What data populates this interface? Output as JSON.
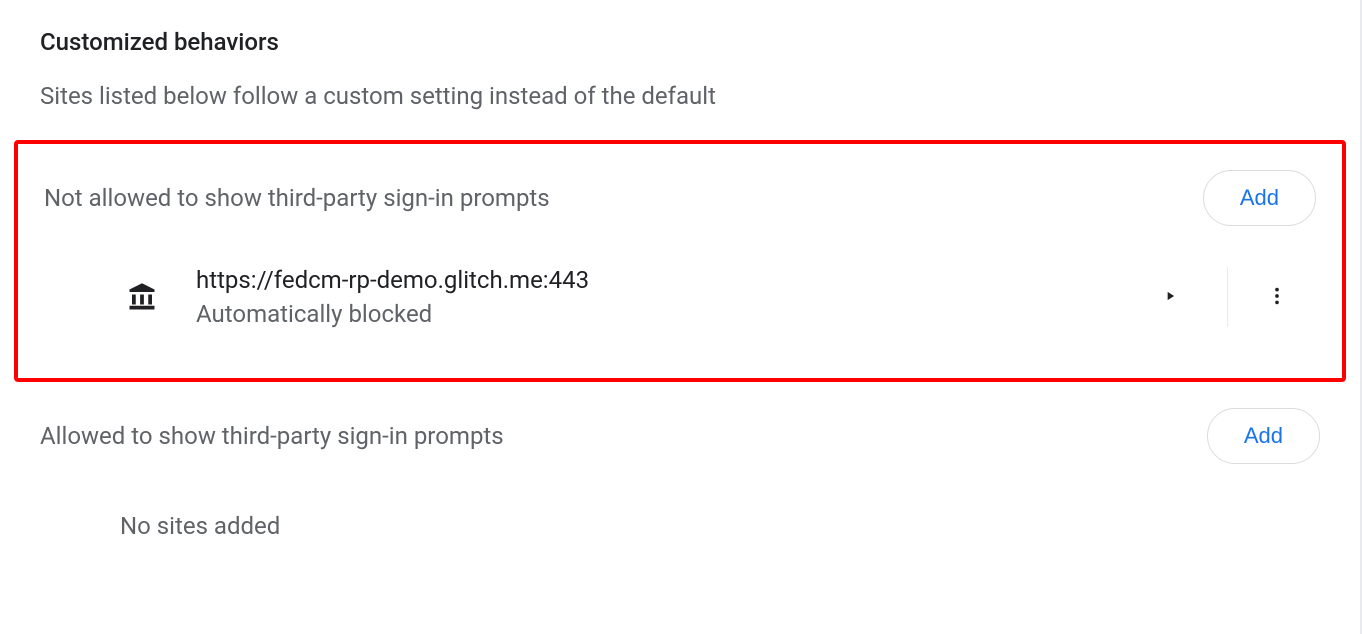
{
  "header": {
    "title": "Customized behaviors",
    "description": "Sites listed below follow a custom setting instead of the default"
  },
  "notAllowed": {
    "label": "Not allowed to show third-party sign-in prompts",
    "addLabel": "Add",
    "sites": [
      {
        "url": "https://fedcm-rp-demo.glitch.me:443",
        "status": "Automatically blocked"
      }
    ]
  },
  "allowed": {
    "label": "Allowed to show third-party sign-in prompts",
    "addLabel": "Add",
    "emptyMessage": "No sites added"
  }
}
